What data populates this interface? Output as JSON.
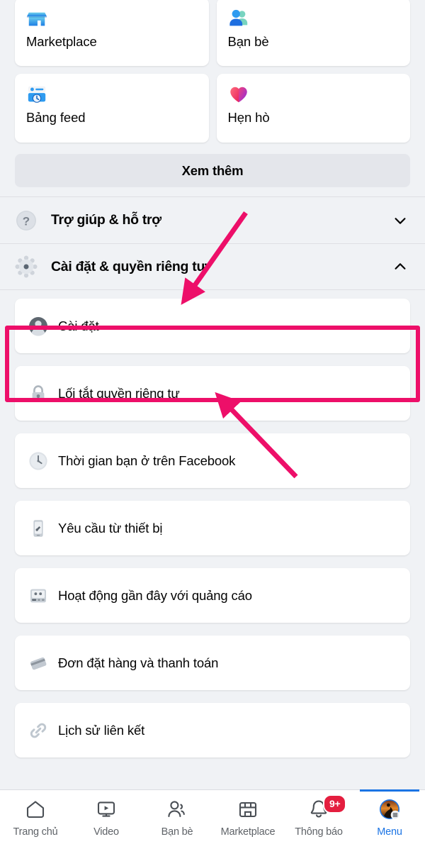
{
  "app": {
    "name": "Facebook",
    "screen_title": "Menu"
  },
  "shortcuts": [
    {
      "label": "Marketplace",
      "icon": "storefront-icon"
    },
    {
      "label": "Bạn bè",
      "icon": "friends-icon"
    },
    {
      "label": "Bảng feed",
      "icon": "feeds-icon"
    },
    {
      "label": "Hẹn hò",
      "icon": "dating-heart-icon"
    }
  ],
  "see_more": {
    "label": "Xem thêm"
  },
  "accordions": [
    {
      "label": "Trợ giúp & hỗ trợ",
      "icon": "question-mark-icon",
      "expanded": false,
      "chevron": "chevron-down-icon"
    },
    {
      "label": "Cài đặt & quyền riêng tư",
      "icon": "gear-icon",
      "expanded": true,
      "chevron": "chevron-up-icon"
    }
  ],
  "settings_items": [
    {
      "label": "Cài đặt",
      "icon": "person-circle-icon",
      "highlighted": true
    },
    {
      "label": "Lối tắt quyền riêng tư",
      "icon": "lock-icon",
      "highlighted": false
    },
    {
      "label": "Thời gian bạn ở trên Facebook",
      "icon": "clock-icon",
      "highlighted": false
    },
    {
      "label": "Yêu cầu từ thiết bị",
      "icon": "device-request-icon",
      "highlighted": false
    },
    {
      "label": "Hoạt động gần đây với quảng cáo",
      "icon": "ad-activity-icon",
      "highlighted": false
    },
    {
      "label": "Đơn đặt hàng và thanh toán",
      "icon": "payment-card-icon",
      "highlighted": false
    },
    {
      "label": "Lịch sử liên kết",
      "icon": "link-chain-icon",
      "highlighted": false
    }
  ],
  "bottom_nav": [
    {
      "label": "Trang chủ",
      "icon": "home-icon",
      "active": false,
      "badge": null
    },
    {
      "label": "Video",
      "icon": "video-icon",
      "active": false,
      "badge": null
    },
    {
      "label": "Bạn bè",
      "icon": "friends-outline-icon",
      "active": false,
      "badge": null
    },
    {
      "label": "Marketplace",
      "icon": "storefront-outline-icon",
      "active": false,
      "badge": null
    },
    {
      "label": "Thông báo",
      "icon": "bell-icon",
      "active": false,
      "badge": "9+"
    },
    {
      "label": "Menu",
      "icon": "avatar-menu-icon",
      "active": true,
      "badge": null
    }
  ],
  "annotations": {
    "highlight_color": "#ED0F69",
    "highlight_target": "Cài đặt",
    "arrows": [
      {
        "name": "arrow-to-settings-privacy",
        "points_to": "Cài đặt & quyền riêng tư"
      },
      {
        "name": "arrow-to-cai-dat",
        "points_to": "Cài đặt"
      }
    ]
  },
  "colors": {
    "page_background": "#F0F2F5",
    "card_background": "#FFFFFF",
    "accent_blue": "#1B74E4",
    "badge_red": "#E41E3F",
    "annotation_pink": "#ED0F69",
    "text_primary": "#050505",
    "text_secondary": "#5F6368"
  }
}
